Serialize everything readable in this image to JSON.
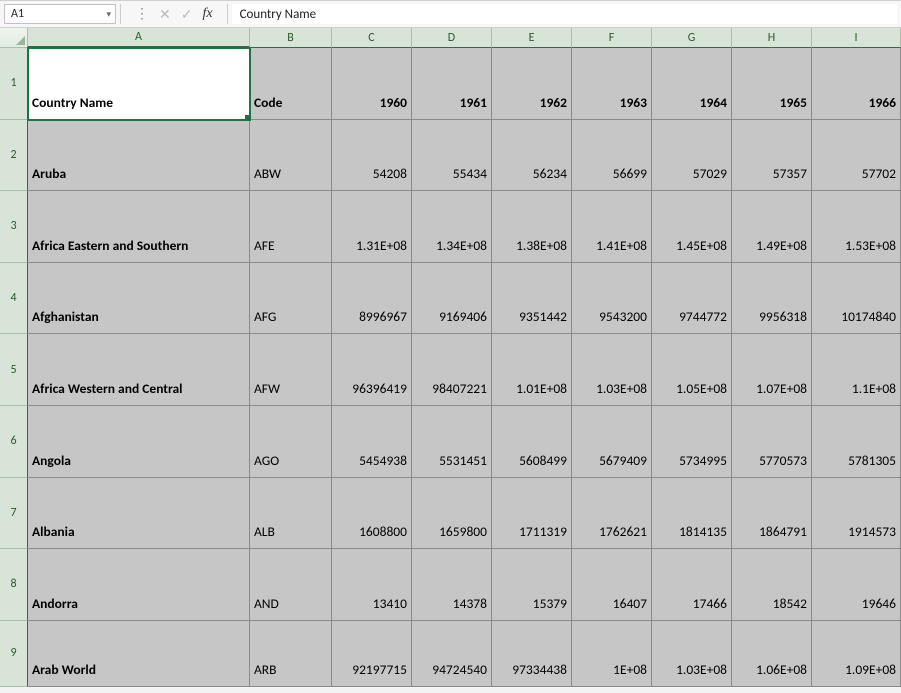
{
  "formula_bar": {
    "name_box_value": "A1",
    "formula_value": "Country Name",
    "cancel_label": "✕",
    "enter_label": "✓",
    "fx_label": "fx",
    "expand_dots": "⋮"
  },
  "columns": [
    "A",
    "B",
    "C",
    "D",
    "E",
    "F",
    "G",
    "H",
    "I"
  ],
  "row_numbers": [
    1,
    2,
    3,
    4,
    5,
    6,
    7,
    8,
    9
  ],
  "active_cell": "A1",
  "table": {
    "header": {
      "A": "Country Name",
      "B": "Code",
      "C": "1960",
      "D": "1961",
      "E": "1962",
      "F": "1963",
      "G": "1964",
      "H": "1965",
      "I": "1966"
    },
    "rows": [
      {
        "A": "Aruba",
        "B": "ABW",
        "C": "54208",
        "D": "55434",
        "E": "56234",
        "F": "56699",
        "G": "57029",
        "H": "57357",
        "I": "57702"
      },
      {
        "A": "Africa Eastern and Southern",
        "B": "AFE",
        "C": "1.31E+08",
        "D": "1.34E+08",
        "E": "1.38E+08",
        "F": "1.41E+08",
        "G": "1.45E+08",
        "H": "1.49E+08",
        "I": "1.53E+08"
      },
      {
        "A": "Afghanistan",
        "B": "AFG",
        "C": "8996967",
        "D": "9169406",
        "E": "9351442",
        "F": "9543200",
        "G": "9744772",
        "H": "9956318",
        "I": "10174840"
      },
      {
        "A": "Africa Western and Central",
        "B": "AFW",
        "C": "96396419",
        "D": "98407221",
        "E": "1.01E+08",
        "F": "1.03E+08",
        "G": "1.05E+08",
        "H": "1.07E+08",
        "I": "1.1E+08"
      },
      {
        "A": "Angola",
        "B": "AGO",
        "C": "5454938",
        "D": "5531451",
        "E": "5608499",
        "F": "5679409",
        "G": "5734995",
        "H": "5770573",
        "I": "5781305"
      },
      {
        "A": "Albania",
        "B": "ALB",
        "C": "1608800",
        "D": "1659800",
        "E": "1711319",
        "F": "1762621",
        "G": "1814135",
        "H": "1864791",
        "I": "1914573"
      },
      {
        "A": "Andorra",
        "B": "AND",
        "C": "13410",
        "D": "14378",
        "E": "15379",
        "F": "16407",
        "G": "17466",
        "H": "18542",
        "I": "19646"
      },
      {
        "A": "Arab World",
        "B": "ARB",
        "C": "92197715",
        "D": "94724540",
        "E": "97334438",
        "F": "1E+08",
        "G": "1.03E+08",
        "H": "1.06E+08",
        "I": "1.09E+08"
      }
    ]
  }
}
